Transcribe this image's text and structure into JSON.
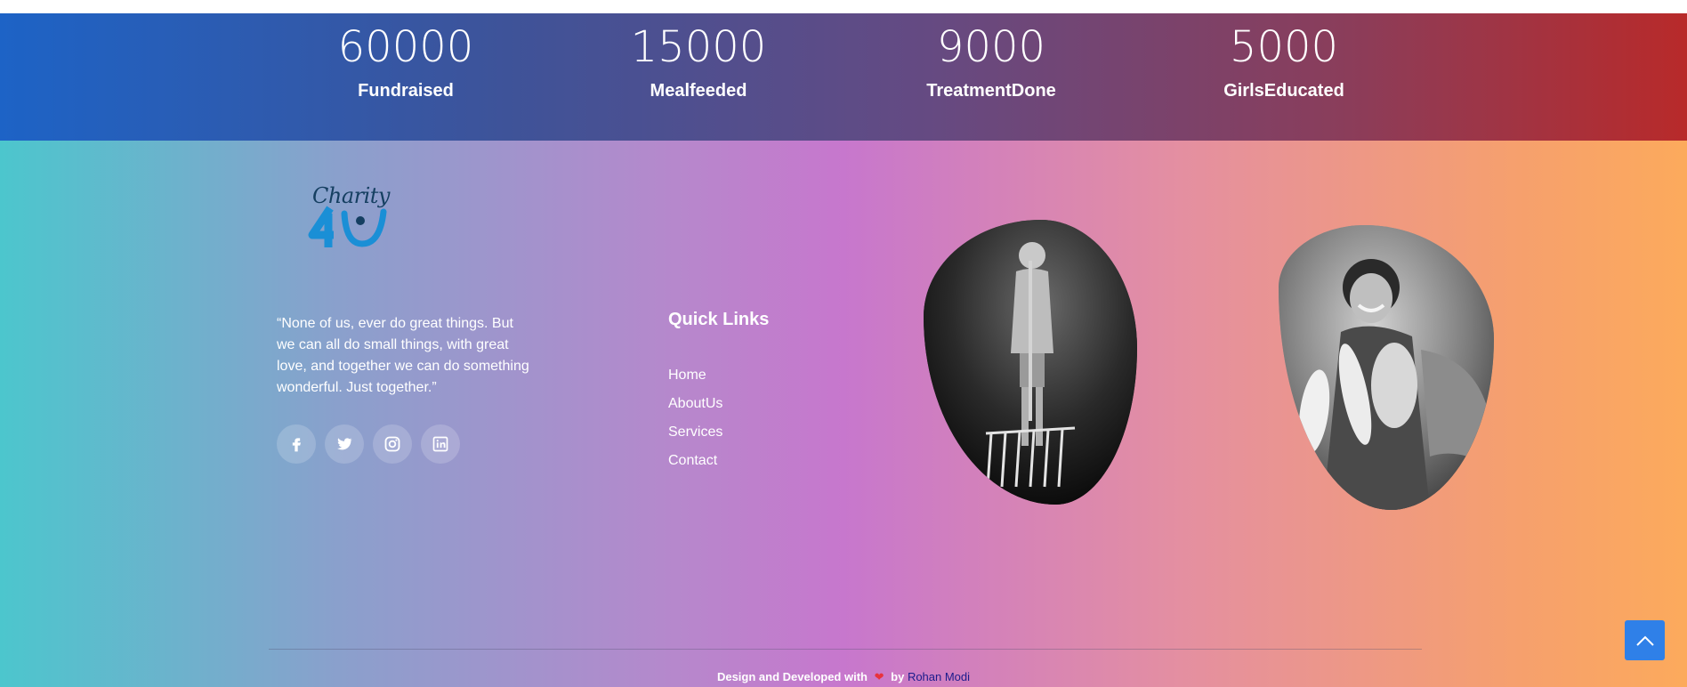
{
  "stats": [
    {
      "value": "60000",
      "label": "Fundraised"
    },
    {
      "value": "15000",
      "label": "Mealfeeded"
    },
    {
      "value": "9000",
      "label": "TreatmentDone"
    },
    {
      "value": "5000",
      "label": "GirlsEducated"
    }
  ],
  "footer": {
    "logo_text": "Charity",
    "quote": "“None of us, ever do great things. But we can all do small things, with great love, and together we can do something wonderful. Just together.”",
    "socials": [
      "facebook-icon",
      "twitter-icon",
      "instagram-icon",
      "linkedin-icon"
    ],
    "quick_links": {
      "title": "Quick Links",
      "items": [
        "Home",
        "AboutUs",
        "Services",
        "Contact"
      ]
    },
    "credit": {
      "prefix": "Design and Developed with",
      "by": "by",
      "author": "Rohan Modi"
    }
  },
  "scroll_top": {
    "icon": "chevron-up-icon"
  },
  "colors": {
    "accent": "#2f80e8",
    "heart": "#e8333d",
    "logo": "#1a8fd6"
  }
}
